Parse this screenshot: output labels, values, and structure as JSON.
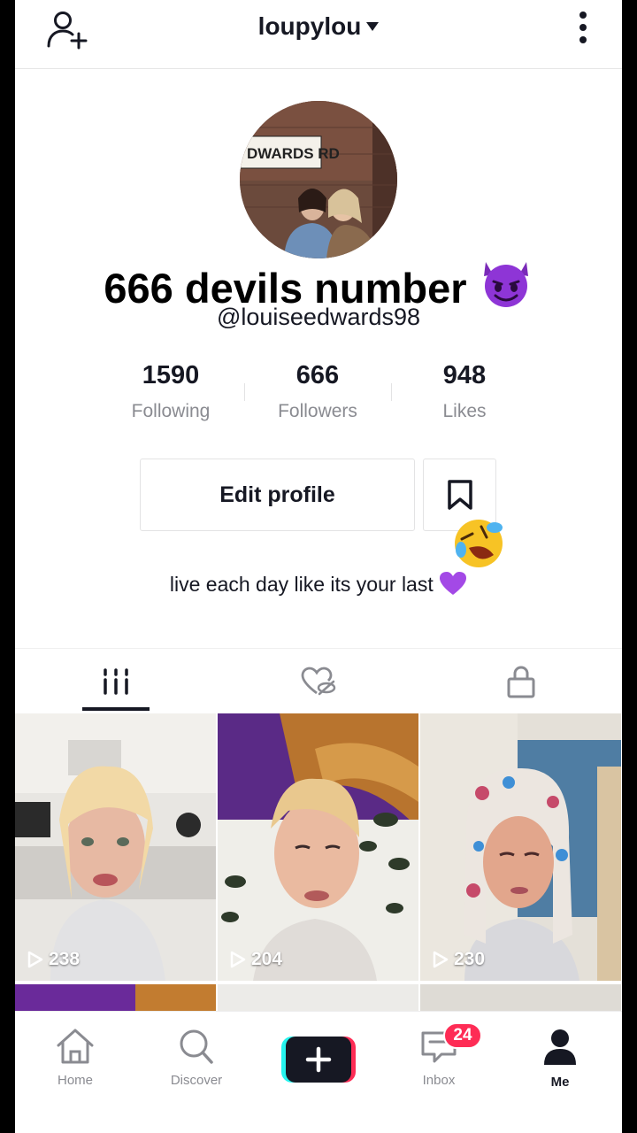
{
  "header": {
    "username": "loupylou",
    "add_friend_icon": "person-add-icon",
    "more_icon": "vertical-dots-icon"
  },
  "profile": {
    "display_name": "666 devils number",
    "handle": "@louiseedwards98",
    "avatar_sign_text": "DWARDS RD",
    "stats": [
      {
        "value": "1590",
        "label": "Following"
      },
      {
        "value": "666",
        "label": "Followers"
      },
      {
        "value": "948",
        "label": "Likes"
      }
    ],
    "edit_profile_label": "Edit profile",
    "bio": "live each day like its your last"
  },
  "tabs": [
    {
      "icon": "grid-icon",
      "active": true
    },
    {
      "icon": "liked-hidden-icon",
      "active": false
    },
    {
      "icon": "lock-icon",
      "active": false
    }
  ],
  "videos": [
    {
      "plays": "238"
    },
    {
      "plays": "204"
    },
    {
      "plays": "230"
    }
  ],
  "nav": {
    "home": "Home",
    "discover": "Discover",
    "inbox": "Inbox",
    "inbox_badge": "24",
    "me": "Me"
  },
  "colors": {
    "accent": "#fe2c55",
    "cyan": "#25f4ee",
    "text": "#161823",
    "muted": "#8a8b91",
    "emoji_purple": "#8e35d6"
  }
}
